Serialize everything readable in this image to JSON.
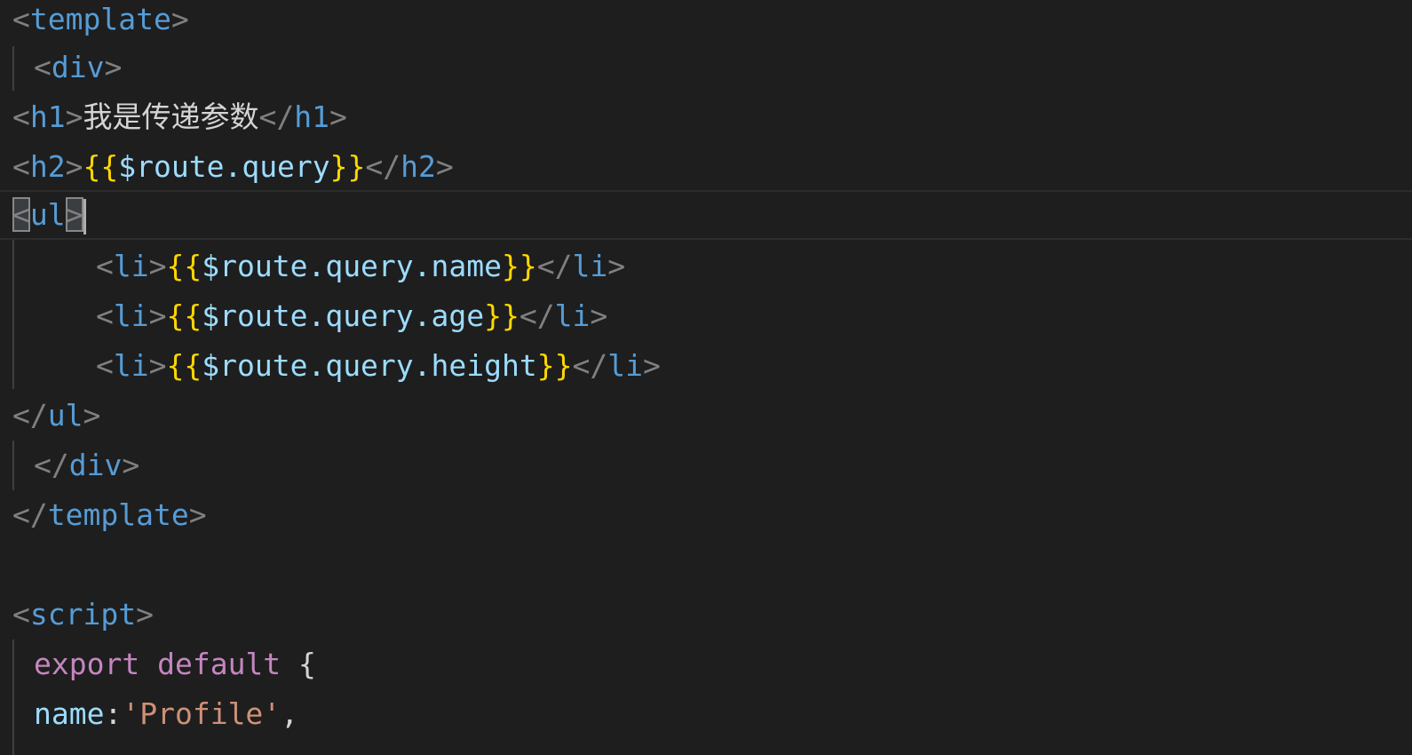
{
  "editor": {
    "lines": [
      {
        "open": "<",
        "tag": "template",
        "close": ">"
      },
      {
        "open": "<",
        "tag": "div",
        "close": ">"
      },
      {
        "open": "<",
        "tag": "h1",
        "close": ">",
        "text": "我是传递参数",
        "end_open": "</",
        "end_tag": "h1",
        "end_close": ">"
      },
      {
        "open": "<",
        "tag": "h2",
        "close": ">",
        "brace_open": "{{",
        "var": "$route.query",
        "brace_close": "}}",
        "end_open": "</",
        "end_tag": "h2",
        "end_close": ">"
      },
      {
        "open": "<",
        "tag": "ul",
        "close": ">"
      },
      {
        "open": "<",
        "tag": "li",
        "close": ">",
        "brace_open": "{{",
        "var": "$route.query.name",
        "brace_close": "}}",
        "end_open": "</",
        "end_tag": "li",
        "end_close": ">"
      },
      {
        "open": "<",
        "tag": "li",
        "close": ">",
        "brace_open": "{{",
        "var": "$route.query.age",
        "brace_close": "}}",
        "end_open": "</",
        "end_tag": "li",
        "end_close": ">"
      },
      {
        "open": "<",
        "tag": "li",
        "close": ">",
        "brace_open": "{{",
        "var": "$route.query.height",
        "brace_close": "}}",
        "end_open": "</",
        "end_tag": "li",
        "end_close": ">"
      },
      {
        "open": "</",
        "tag": "ul",
        "close": ">"
      },
      {
        "open": "</",
        "tag": "div",
        "close": ">"
      },
      {
        "open": "</",
        "tag": "template",
        "close": ">"
      },
      {},
      {
        "open": "<",
        "tag": "script",
        "close": ">"
      },
      {
        "keyword1": "export",
        "keyword2": "default",
        "brace": "{"
      },
      {
        "prop": "name",
        "colon": ":",
        "string": "'Profile'",
        "comma": ","
      }
    ]
  },
  "colors": {
    "background": "#1e1e1e",
    "punctuation": "#808080",
    "tag": "#569cd6",
    "text": "#d4d4d4",
    "brace": "#ffd700",
    "variable": "#9cdcfe",
    "keyword": "#c586c0",
    "string": "#ce9178"
  }
}
